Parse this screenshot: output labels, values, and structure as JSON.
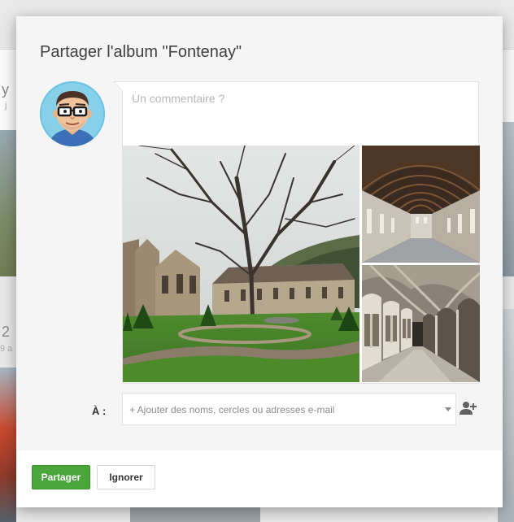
{
  "dialog": {
    "title": "Partager l'album \"Fontenay\""
  },
  "comment": {
    "placeholder": "Un commentaire ?"
  },
  "recipients": {
    "label": "À :",
    "placeholder": "+ Ajouter des noms, cercles ou adresses e-mail"
  },
  "footer": {
    "share_label": "Partager",
    "ignore_label": "Ignorer"
  },
  "background": {
    "fragment_1": "y",
    "fragment_2": "2",
    "fragment_3": "j",
    "fragment_4": "9 a"
  },
  "colors": {
    "accent": "#4aa53b",
    "dialog_bg": "#f5f5f5"
  },
  "icons": {
    "avatar": "user-avatar",
    "add_person": "person-add-icon",
    "dropdown": "chevron-down-icon"
  }
}
